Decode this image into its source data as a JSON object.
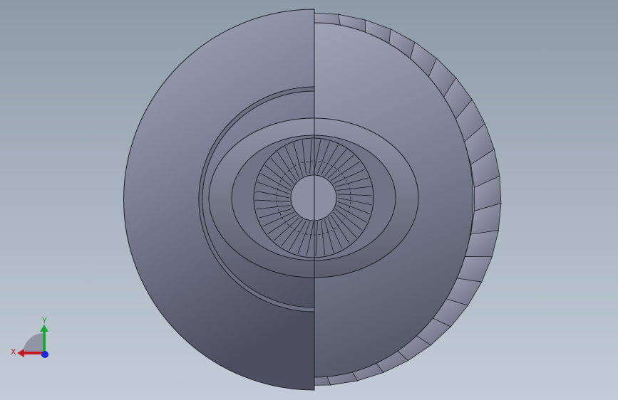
{
  "scene": {
    "model": "centrifugal-impeller",
    "colors": {
      "background_top": "#8e9aa8",
      "background_bottom": "#c3ccd6",
      "part_light": "#a2a6b8",
      "part_dark": "#4e5262",
      "edge": "#1c1e26",
      "blade": "#8a8ea0"
    }
  },
  "triad": {
    "x_label": "X",
    "y_label": "Y",
    "x_color": "#c81a1a",
    "y_color": "#1aa83a",
    "z_color": "#1a2ad8"
  }
}
